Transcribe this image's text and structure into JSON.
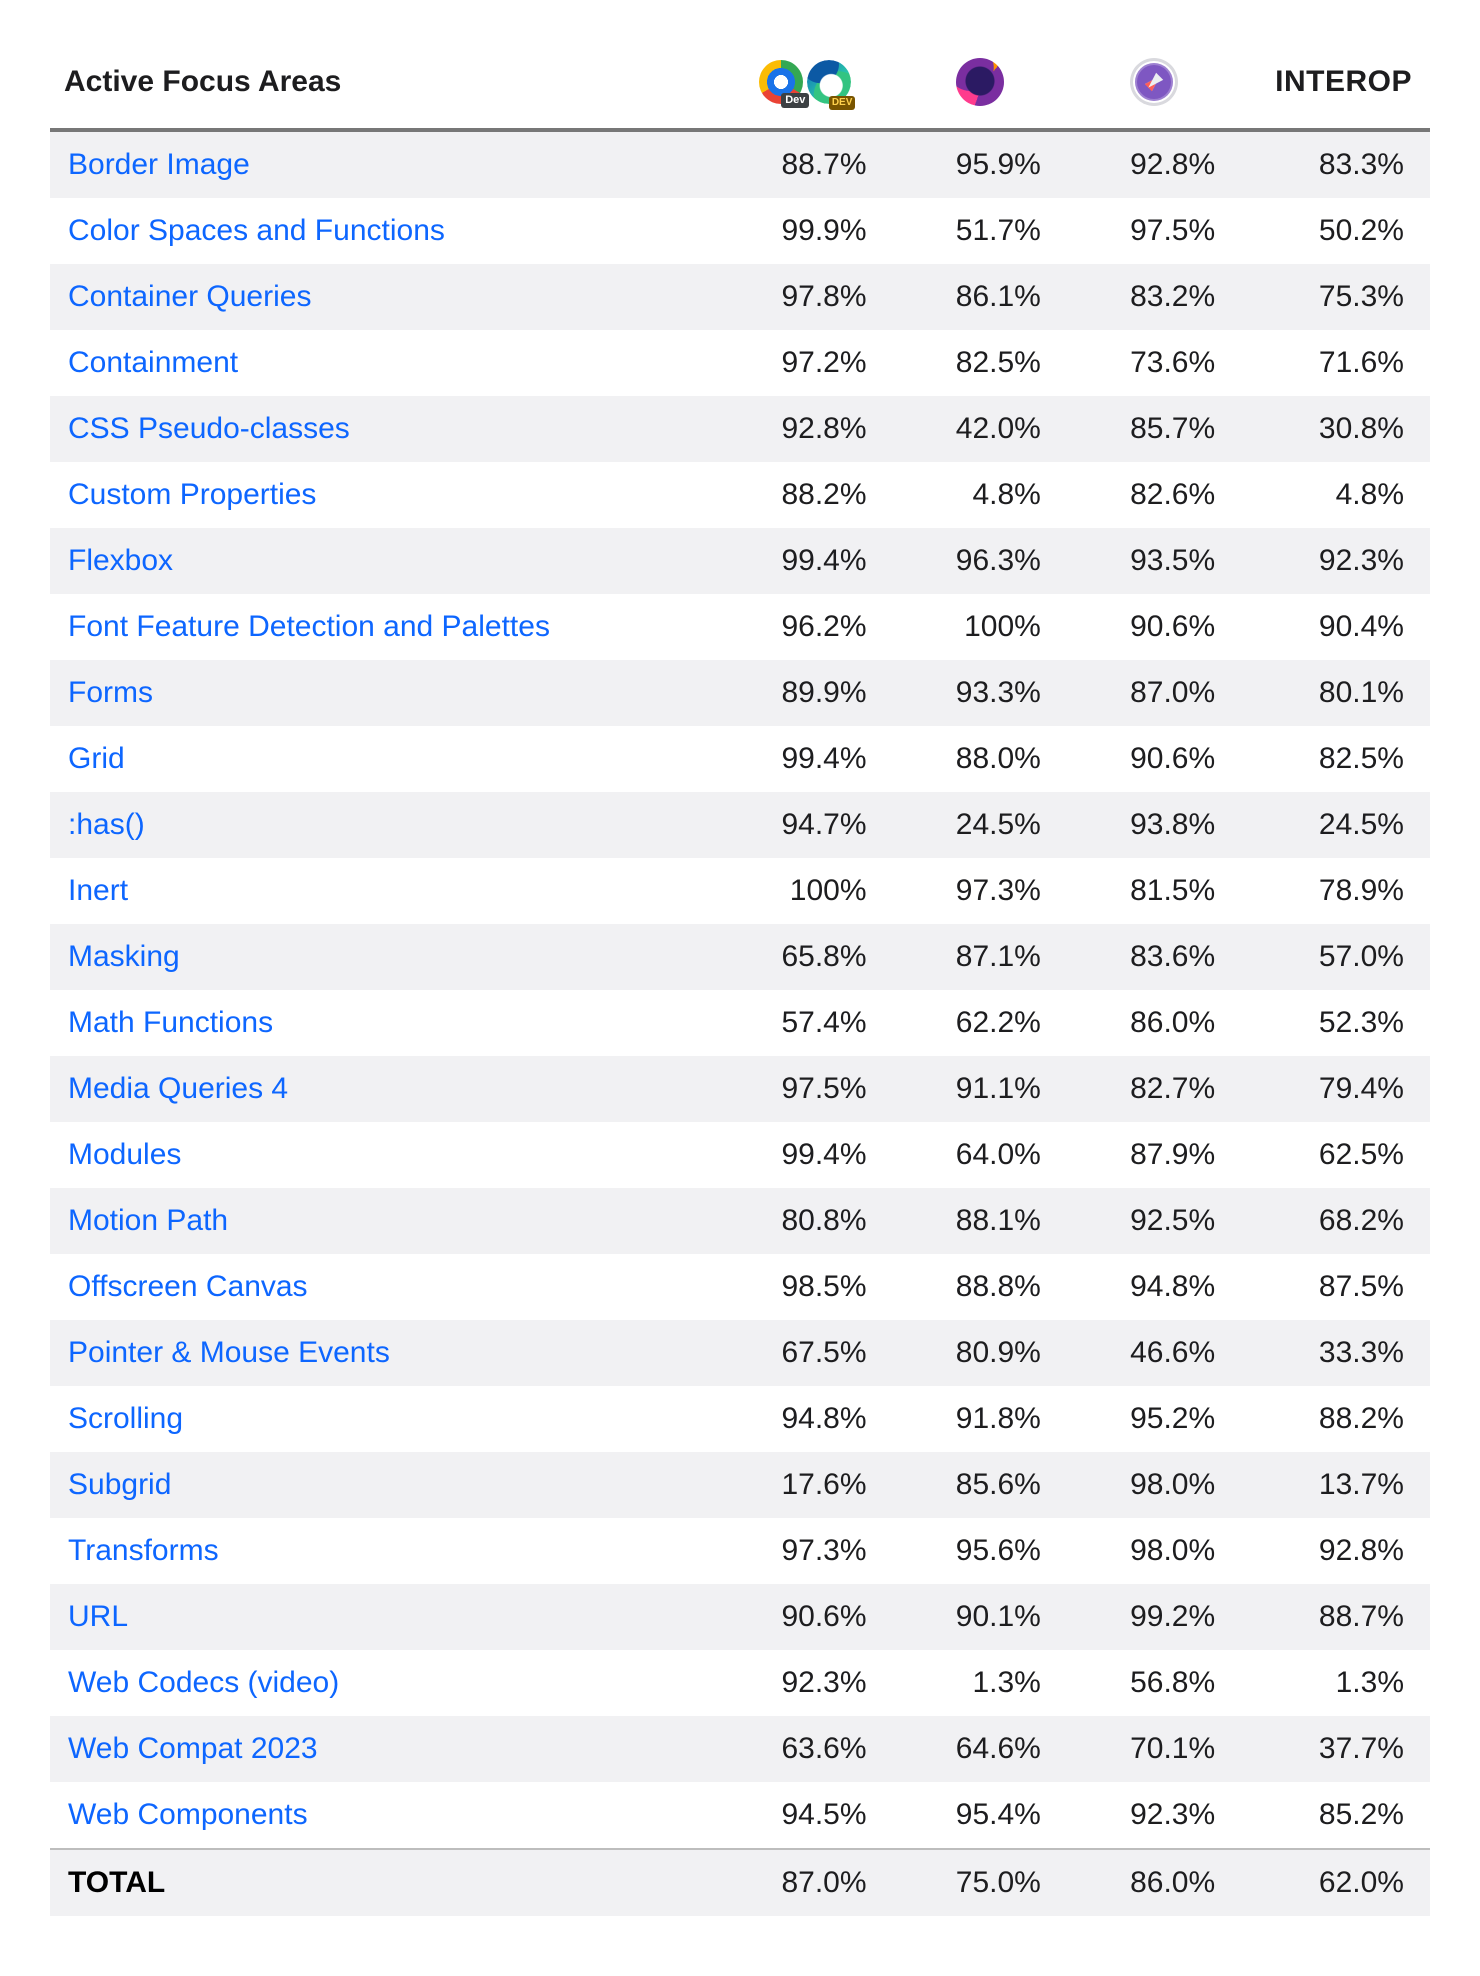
{
  "header": {
    "title": "Active Focus Areas",
    "interop_label": "INTEROP",
    "browser_icons": {
      "col1": [
        "chrome-dev-icon",
        "edge-dev-icon"
      ],
      "col2": [
        "firefox-nightly-icon"
      ],
      "col3": [
        "safari-tp-icon"
      ]
    }
  },
  "rows": [
    {
      "name": "Border Image",
      "b1": "88.7%",
      "b2": "95.9%",
      "b3": "92.8%",
      "interop": "83.3%"
    },
    {
      "name": "Color Spaces and Functions",
      "b1": "99.9%",
      "b2": "51.7%",
      "b3": "97.5%",
      "interop": "50.2%"
    },
    {
      "name": "Container Queries",
      "b1": "97.8%",
      "b2": "86.1%",
      "b3": "83.2%",
      "interop": "75.3%"
    },
    {
      "name": "Containment",
      "b1": "97.2%",
      "b2": "82.5%",
      "b3": "73.6%",
      "interop": "71.6%"
    },
    {
      "name": "CSS Pseudo-classes",
      "b1": "92.8%",
      "b2": "42.0%",
      "b3": "85.7%",
      "interop": "30.8%"
    },
    {
      "name": "Custom Properties",
      "b1": "88.2%",
      "b2": "4.8%",
      "b3": "82.6%",
      "interop": "4.8%"
    },
    {
      "name": "Flexbox",
      "b1": "99.4%",
      "b2": "96.3%",
      "b3": "93.5%",
      "interop": "92.3%"
    },
    {
      "name": "Font Feature Detection and Palettes",
      "b1": "96.2%",
      "b2": "100%",
      "b3": "90.6%",
      "interop": "90.4%"
    },
    {
      "name": "Forms",
      "b1": "89.9%",
      "b2": "93.3%",
      "b3": "87.0%",
      "interop": "80.1%"
    },
    {
      "name": "Grid",
      "b1": "99.4%",
      "b2": "88.0%",
      "b3": "90.6%",
      "interop": "82.5%"
    },
    {
      "name": ":has()",
      "b1": "94.7%",
      "b2": "24.5%",
      "b3": "93.8%",
      "interop": "24.5%"
    },
    {
      "name": "Inert",
      "b1": "100%",
      "b2": "97.3%",
      "b3": "81.5%",
      "interop": "78.9%"
    },
    {
      "name": "Masking",
      "b1": "65.8%",
      "b2": "87.1%",
      "b3": "83.6%",
      "interop": "57.0%"
    },
    {
      "name": "Math Functions",
      "b1": "57.4%",
      "b2": "62.2%",
      "b3": "86.0%",
      "interop": "52.3%"
    },
    {
      "name": "Media Queries 4",
      "b1": "97.5%",
      "b2": "91.1%",
      "b3": "82.7%",
      "interop": "79.4%"
    },
    {
      "name": "Modules",
      "b1": "99.4%",
      "b2": "64.0%",
      "b3": "87.9%",
      "interop": "62.5%"
    },
    {
      "name": "Motion Path",
      "b1": "80.8%",
      "b2": "88.1%",
      "b3": "92.5%",
      "interop": "68.2%"
    },
    {
      "name": "Offscreen Canvas",
      "b1": "98.5%",
      "b2": "88.8%",
      "b3": "94.8%",
      "interop": "87.5%"
    },
    {
      "name": "Pointer & Mouse Events",
      "b1": "67.5%",
      "b2": "80.9%",
      "b3": "46.6%",
      "interop": "33.3%"
    },
    {
      "name": "Scrolling",
      "b1": "94.8%",
      "b2": "91.8%",
      "b3": "95.2%",
      "interop": "88.2%"
    },
    {
      "name": "Subgrid",
      "b1": "17.6%",
      "b2": "85.6%",
      "b3": "98.0%",
      "interop": "13.7%"
    },
    {
      "name": "Transforms",
      "b1": "97.3%",
      "b2": "95.6%",
      "b3": "98.0%",
      "interop": "92.8%"
    },
    {
      "name": "URL",
      "b1": "90.6%",
      "b2": "90.1%",
      "b3": "99.2%",
      "interop": "88.7%"
    },
    {
      "name": "Web Codecs (video)",
      "b1": "92.3%",
      "b2": "1.3%",
      "b3": "56.8%",
      "interop": "1.3%"
    },
    {
      "name": "Web Compat 2023",
      "b1": "63.6%",
      "b2": "64.6%",
      "b3": "70.1%",
      "interop": "37.7%"
    },
    {
      "name": "Web Components",
      "b1": "94.5%",
      "b2": "95.4%",
      "b3": "92.3%",
      "interop": "85.2%"
    }
  ],
  "total": {
    "name": "TOTAL",
    "b1": "87.0%",
    "b2": "75.0%",
    "b3": "86.0%",
    "interop": "62.0%"
  },
  "chart_data": {
    "type": "table",
    "title": "Active Focus Areas",
    "columns": [
      "Area",
      "Chrome/Edge Dev",
      "Firefox Nightly",
      "Safari TP",
      "INTEROP"
    ],
    "rows": [
      [
        "Border Image",
        88.7,
        95.9,
        92.8,
        83.3
      ],
      [
        "Color Spaces and Functions",
        99.9,
        51.7,
        97.5,
        50.2
      ],
      [
        "Container Queries",
        97.8,
        86.1,
        83.2,
        75.3
      ],
      [
        "Containment",
        97.2,
        82.5,
        73.6,
        71.6
      ],
      [
        "CSS Pseudo-classes",
        92.8,
        42.0,
        85.7,
        30.8
      ],
      [
        "Custom Properties",
        88.2,
        4.8,
        82.6,
        4.8
      ],
      [
        "Flexbox",
        99.4,
        96.3,
        93.5,
        92.3
      ],
      [
        "Font Feature Detection and Palettes",
        96.2,
        100,
        90.6,
        90.4
      ],
      [
        "Forms",
        89.9,
        93.3,
        87.0,
        80.1
      ],
      [
        "Grid",
        99.4,
        88.0,
        90.6,
        82.5
      ],
      [
        ":has()",
        94.7,
        24.5,
        93.8,
        24.5
      ],
      [
        "Inert",
        100,
        97.3,
        81.5,
        78.9
      ],
      [
        "Masking",
        65.8,
        87.1,
        83.6,
        57.0
      ],
      [
        "Math Functions",
        57.4,
        62.2,
        86.0,
        52.3
      ],
      [
        "Media Queries 4",
        97.5,
        91.1,
        82.7,
        79.4
      ],
      [
        "Modules",
        99.4,
        64.0,
        87.9,
        62.5
      ],
      [
        "Motion Path",
        80.8,
        88.1,
        92.5,
        68.2
      ],
      [
        "Offscreen Canvas",
        98.5,
        88.8,
        94.8,
        87.5
      ],
      [
        "Pointer & Mouse Events",
        67.5,
        80.9,
        46.6,
        33.3
      ],
      [
        "Scrolling",
        94.8,
        91.8,
        95.2,
        88.2
      ],
      [
        "Subgrid",
        17.6,
        85.6,
        98.0,
        13.7
      ],
      [
        "Transforms",
        97.3,
        95.6,
        98.0,
        92.8
      ],
      [
        "URL",
        90.6,
        90.1,
        99.2,
        88.7
      ],
      [
        "Web Codecs (video)",
        92.3,
        1.3,
        56.8,
        1.3
      ],
      [
        "Web Compat 2023",
        63.6,
        64.6,
        70.1,
        37.7
      ],
      [
        "Web Components",
        94.5,
        95.4,
        92.3,
        85.2
      ]
    ],
    "total": [
      "TOTAL",
      87.0,
      75.0,
      86.0,
      62.0
    ],
    "unit": "percent"
  }
}
